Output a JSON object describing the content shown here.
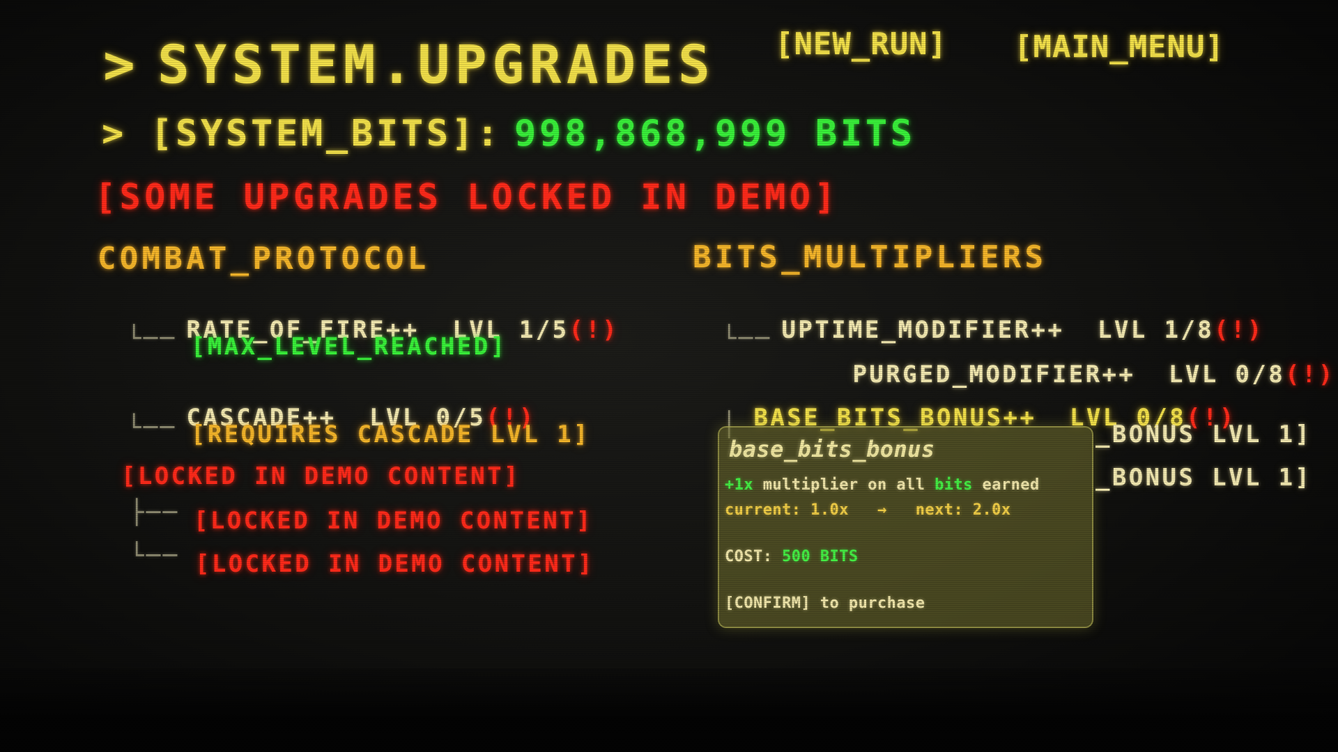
{
  "header": {
    "prompt": ">",
    "title": "SYSTEM.UPGRADES",
    "new_run": "[NEW_RUN]",
    "main_menu": "[MAIN_MENU]"
  },
  "bits": {
    "prompt": ">",
    "label": "[SYSTEM_BITS]:",
    "value": "998,868,999 BITS"
  },
  "demo_warning": "[SOME UPGRADES LOCKED IN DEMO]",
  "combat": {
    "title": "COMBAT_PROTOCOL",
    "rate_of_fire": {
      "name": "RATE_OF_FIRE++",
      "level": "LVL 1/5",
      "alert": "(!)"
    },
    "rate_child": "[MAX_LEVEL_REACHED]",
    "cascade": {
      "name": "CASCADE++",
      "level": "LVL 0/5",
      "alert": "(!)"
    },
    "cascade_child": "[REQUIRES CASCADE LVL 1]",
    "locked_main": "[LOCKED IN DEMO CONTENT]",
    "locked_child_1": "[LOCKED IN DEMO CONTENT]",
    "locked_child_2": "[LOCKED IN DEMO CONTENT]"
  },
  "multipliers": {
    "title": "BITS_MULTIPLIERS",
    "uptime": {
      "name": "UPTIME_MODIFIER++",
      "level": "LVL 1/8",
      "alert": "(!)"
    },
    "purged": {
      "name": "PURGED_MODIFIER++",
      "level": "LVL 0/8",
      "alert": "(!)"
    },
    "base_bits": {
      "name": "BASE_BITS_BONUS++",
      "level": "LVL 0/8",
      "alert": "(!)"
    },
    "req_1": "_BONUS LVL 1]",
    "req_2": "_BONUS LVL 1]"
  },
  "tooltip": {
    "title": "base_bits_bonus",
    "gain": "+1x",
    "desc_a": " multiplier on all ",
    "desc_bits": "bits",
    "desc_b": " earned",
    "current": "current: 1.0x   →   next: 2.0x",
    "cost_label": "COST: ",
    "cost_value": "500 BITS",
    "confirm": "[CONFIRM] to purchase"
  },
  "colors": {
    "yellow": "#f2e04a",
    "orange": "#f4b52a",
    "green": "#39f03a",
    "red": "#ff2a1a",
    "tooltip_bg": "#78762f"
  }
}
